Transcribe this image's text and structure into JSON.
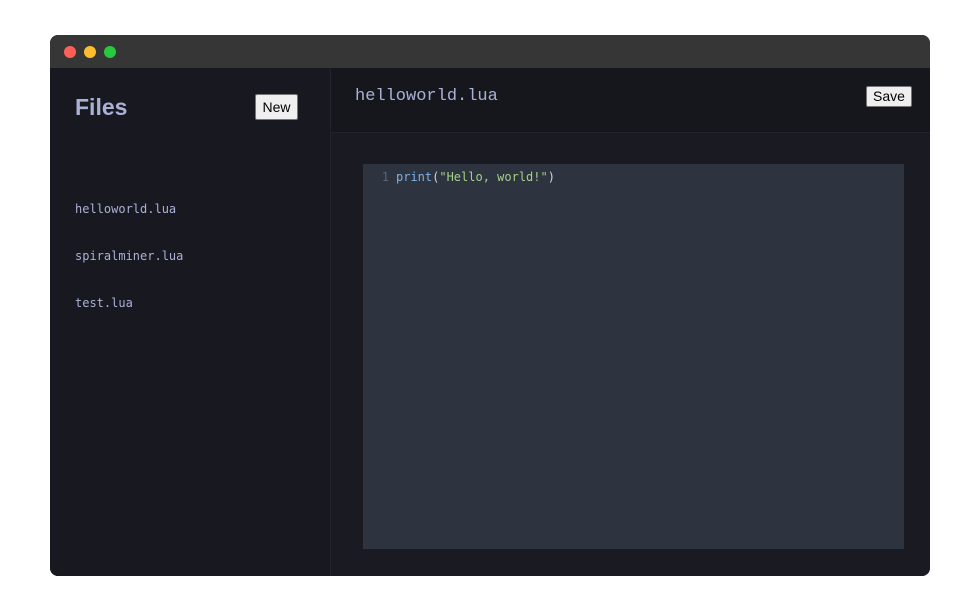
{
  "window": {
    "controls": [
      {
        "name": "close",
        "color": "#ff5f57"
      },
      {
        "name": "minimize",
        "color": "#febc2e"
      },
      {
        "name": "maximize",
        "color": "#28c840"
      }
    ]
  },
  "sidebar": {
    "title": "Files",
    "new_button_label": "New",
    "files": [
      {
        "name": "helloworld.lua"
      },
      {
        "name": "spiralminer.lua"
      },
      {
        "name": "test.lua"
      }
    ]
  },
  "editor": {
    "filename": "helloworld.lua",
    "save_button_label": "Save",
    "lines": [
      {
        "number": "1",
        "tokens": [
          {
            "text": "print",
            "kind": "fn"
          },
          {
            "text": "(",
            "kind": "punc"
          },
          {
            "text": "\"Hello, world!\"",
            "kind": "str"
          },
          {
            "text": ")",
            "kind": "punc"
          }
        ]
      }
    ]
  },
  "colors": {
    "accent_text": "#a9b1d6",
    "editor_background": "#2d333f",
    "sidebar_background": "#181920"
  }
}
